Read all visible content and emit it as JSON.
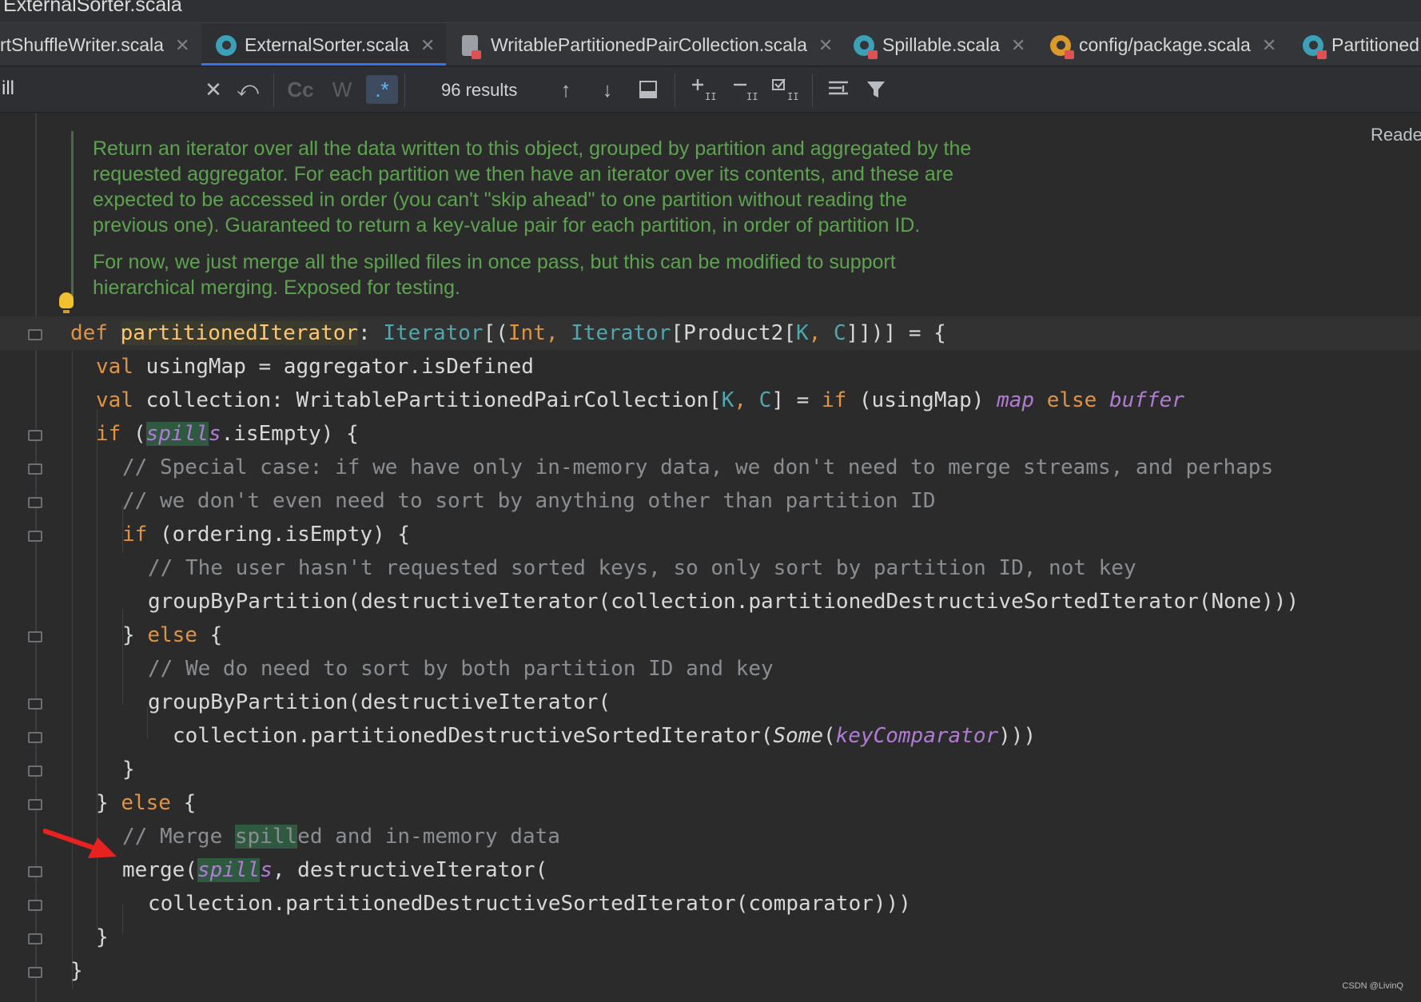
{
  "window": {
    "title": "ExternalSorter.scala"
  },
  "tabs": [
    {
      "label": "rtShuffleWriter.scala"
    },
    {
      "label": "ExternalSorter.scala"
    },
    {
      "label": "WritablePartitionedPairCollection.scala"
    },
    {
      "label": "Spillable.scala"
    },
    {
      "label": "config/package.scala"
    },
    {
      "label": "Partitioned"
    }
  ],
  "find": {
    "query": "ill",
    "match_case_label": "Cc",
    "words_label": "W",
    "regex_label": ".*",
    "results": "96 results"
  },
  "editor": {
    "reader_mode": "Reade",
    "doc": [
      "Return an iterator over all the data written to this object, grouped by partition and aggregated by the",
      "requested aggregator. For each partition we then have an iterator over its contents, and these are",
      "expected to be accessed in order (you can't \"skip ahead\" to one partition without reading the",
      "previous one). Guaranteed to return a key-value pair for each partition, in order of partition ID.",
      "For now, we just merge all the spilled files in once pass, but this can be modified to support",
      "hierarchical merging. Exposed for testing."
    ],
    "code": {
      "l1": {
        "kw": "def",
        "name": "partitionedIterator",
        "colon": ": ",
        "t1": "Iterator",
        "b1": "[(",
        "t2": "Int",
        "c1": ", ",
        "t3": "Iterator",
        "b2": "[",
        "t4": "Product2",
        "b3": "[",
        "p1": "K",
        "c2": ", ",
        "p2": "C",
        "rest": "]])] = {"
      },
      "l2": {
        "kw": "val",
        "rest": " usingMap = aggregator.isDefined"
      },
      "l3": {
        "kw": "val",
        "a": " collection: WritablePartitionedPairCollection[",
        "p1": "K",
        "c": ", ",
        "p2": "C",
        "b": "] = ",
        "kw2": "if",
        "d": " (usingMap) ",
        "i1": "map",
        "sp": " ",
        "kw3": "else",
        "sp2": " ",
        "i2": "buffer"
      },
      "l4": {
        "kw": "if",
        "a": " (",
        "hl": "spill",
        "hl2": "s",
        "b": ".isEmpty) {"
      },
      "l5": "// Special case: if we have only in-memory data, we don't need to merge streams, and perhaps",
      "l6": "// we don't even need to sort by anything other than partition ID",
      "l7": {
        "kw": "if",
        "rest": " (ordering.isEmpty) {"
      },
      "l8": "// The user hasn't requested sorted keys, so only sort by partition ID, not key",
      "l9": "groupByPartition(destructiveIterator(collection.partitionedDestructiveSortedIterator(None)))",
      "l10": {
        "a": "} ",
        "kw": "else",
        "b": " {"
      },
      "l11": "// We do need to sort by both partition ID and key",
      "l12": "groupByPartition(destructiveIterator(",
      "l13": {
        "a": "collection.partitionedDestructiveSortedIterator(",
        "i1": "Some",
        "b": "(",
        "i2": "keyComparator",
        "c": ")))"
      },
      "l14": "}",
      "l15": {
        "a": "} ",
        "kw": "else",
        "b": " {"
      },
      "l16": {
        "a": "// Merge ",
        "hl": "spill",
        "b": "ed and in-memory data"
      },
      "l17": {
        "a": "merge(",
        "hl": "spill",
        "hl2": "s",
        "b": ", destructiveIterator("
      },
      "l18": "collection.partitionedDestructiveSortedIterator(comparator)))",
      "l19": "}",
      "l20": "}"
    }
  },
  "watermark": "CSDN @LivinQ",
  "colors": {
    "annotation_arrow": "#e8231f",
    "active_tab_underline": "#3574f0"
  }
}
